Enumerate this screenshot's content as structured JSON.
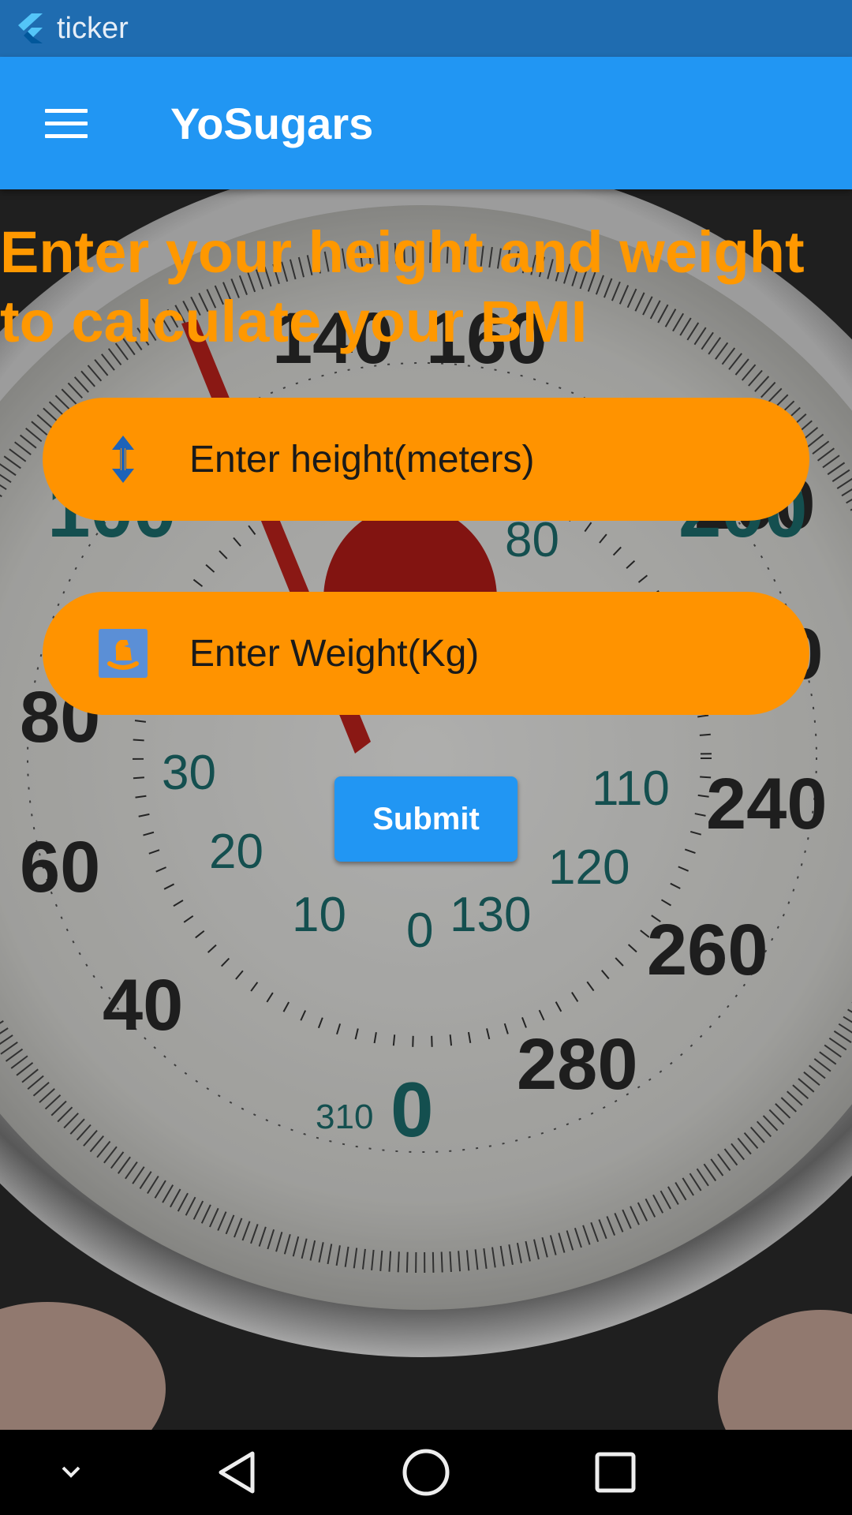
{
  "window": {
    "title": "ticker"
  },
  "appbar": {
    "title": "YoSugars",
    "menu_icon": "hamburger-menu-icon"
  },
  "main": {
    "headline": "Enter your height and weight to calculate your BMI",
    "height_field": {
      "placeholder": "Enter height(meters)",
      "icon": "vertical-arrows-icon"
    },
    "weight_field": {
      "placeholder": "Enter Weight(Kg)",
      "icon": "rocking-horse-icon"
    },
    "submit_label": "Submit"
  },
  "navbar": {
    "items": [
      "chevron-down-icon",
      "back-icon",
      "home-icon",
      "recents-icon"
    ]
  },
  "colors": {
    "appbar": "#2196f3",
    "statusbar": "#1f6cb0",
    "accent_orange": "#ff9300",
    "submit": "#2196f3"
  }
}
